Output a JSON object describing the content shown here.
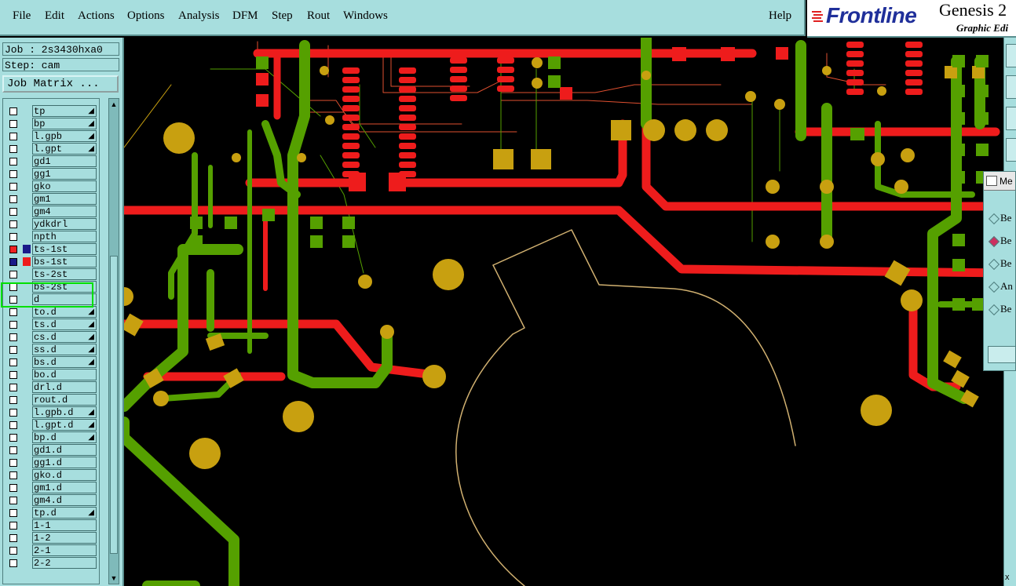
{
  "menubar": {
    "items": [
      {
        "label": "File"
      },
      {
        "label": "Edit"
      },
      {
        "label": "Actions"
      },
      {
        "label": "Options"
      },
      {
        "label": "Analysis"
      },
      {
        "label": "DFM"
      },
      {
        "label": "Step"
      },
      {
        "label": "Rout"
      },
      {
        "label": "Windows"
      }
    ],
    "help": "Help"
  },
  "branding": {
    "logo": "Frontline",
    "product": "Genesis 2",
    "subtitle": "Graphic Edi"
  },
  "info": {
    "job": "Job : 2s3430hxa0",
    "step": "Step: cam"
  },
  "job_matrix_button": "Job Matrix ...",
  "layers": [
    {
      "name": "tp",
      "flag": true
    },
    {
      "name": "bp",
      "flag": true
    },
    {
      "name": "l.gpb",
      "flag": true
    },
    {
      "name": "l.gpt",
      "flag": true
    },
    {
      "name": "gd1",
      "flag": false
    },
    {
      "name": "gg1",
      "flag": false
    },
    {
      "name": "gko",
      "flag": false
    },
    {
      "name": "gm1",
      "flag": false
    },
    {
      "name": "gm4",
      "flag": false
    },
    {
      "name": "ydkdrl",
      "flag": false
    },
    {
      "name": "npth",
      "flag": false
    },
    {
      "name": "ts-1st",
      "flag": false,
      "active": true,
      "color": "#ee2222"
    },
    {
      "name": "bs-1st",
      "flag": false,
      "active": true,
      "color": "#1a1a8a"
    },
    {
      "name": "ts-2st",
      "flag": false
    },
    {
      "name": "bs-2st",
      "flag": false
    },
    {
      "name": "d",
      "flag": false
    },
    {
      "name": "to.d",
      "flag": true
    },
    {
      "name": "ts.d",
      "flag": true
    },
    {
      "name": "cs.d",
      "flag": true
    },
    {
      "name": "ss.d",
      "flag": true
    },
    {
      "name": "bs.d",
      "flag": true
    },
    {
      "name": "bo.d",
      "flag": false
    },
    {
      "name": "drl.d",
      "flag": false
    },
    {
      "name": "rout.d",
      "flag": false
    },
    {
      "name": "l.gpb.d",
      "flag": true
    },
    {
      "name": "l.gpt.d",
      "flag": true
    },
    {
      "name": "bp.d",
      "flag": true
    },
    {
      "name": "gd1.d",
      "flag": false
    },
    {
      "name": "gg1.d",
      "flag": false
    },
    {
      "name": "gko.d",
      "flag": false
    },
    {
      "name": "gm1.d",
      "flag": false
    },
    {
      "name": "gm4.d",
      "flag": false
    },
    {
      "name": "tp.d",
      "flag": true
    },
    {
      "name": "1-1",
      "flag": false
    },
    {
      "name": "1-2",
      "flag": false
    },
    {
      "name": "2-1",
      "flag": false
    },
    {
      "name": "2-2",
      "flag": false
    }
  ],
  "popup": {
    "title": "Me",
    "options": [
      {
        "label": "Be",
        "selected": false
      },
      {
        "label": "Be",
        "selected": true
      },
      {
        "label": "Be",
        "selected": false
      },
      {
        "label": "An",
        "selected": false
      },
      {
        "label": "Be",
        "selected": false
      }
    ]
  },
  "colors": {
    "panel": "#a7dede",
    "top_layer": "#ee1c1c",
    "bottom_layer": "#55a000",
    "pad": "#c8a010"
  },
  "bottom_right": "x"
}
